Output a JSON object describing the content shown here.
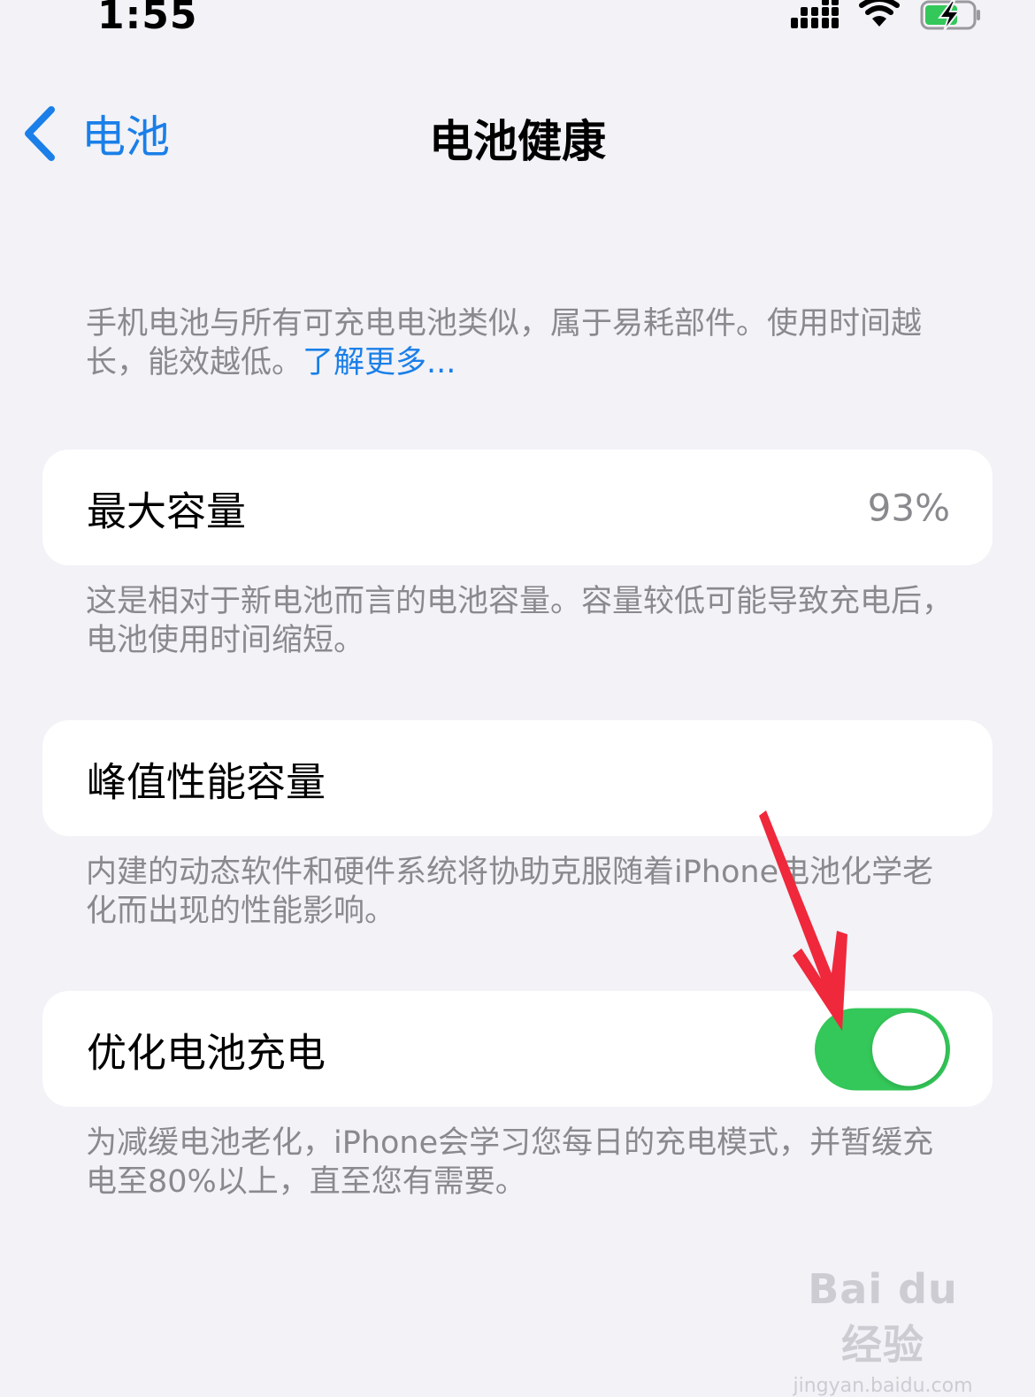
{
  "status_bar": {
    "time": "1:55",
    "icons": [
      "signal-icon",
      "wifi-icon",
      "battery-charging-icon"
    ]
  },
  "nav": {
    "back_label": "电池",
    "title": "电池健康"
  },
  "intro": {
    "text": "手机电池与所有可充电电池类似，属于易耗部件。使用时间越长，能效越低。",
    "link": "了解更多..."
  },
  "max_capacity": {
    "label": "最大容量",
    "value": "93%",
    "footnote": "这是相对于新电池而言的电池容量。容量较低可能导致充电后，电池使用时间缩短。"
  },
  "peak_performance": {
    "label": "峰值性能容量",
    "footnote": "内建的动态软件和硬件系统将协助克服随着iPhone电池化学老化而出现的性能影响。"
  },
  "optimized_charging": {
    "label": "优化电池充电",
    "enabled": true,
    "footnote": "为减缓电池老化，iPhone会学习您每日的充电模式，并暂缓充电至80%以上，直至您有需要。"
  },
  "colors": {
    "background": "#f2f2f7",
    "accent": "#1a7fe8",
    "toggle_on": "#34c759",
    "secondary_text": "#8a8a8e",
    "annotation_arrow": "#f0283c"
  },
  "watermark": {
    "logo": "Bai du 经验",
    "url": "jingyan.baidu.com"
  }
}
